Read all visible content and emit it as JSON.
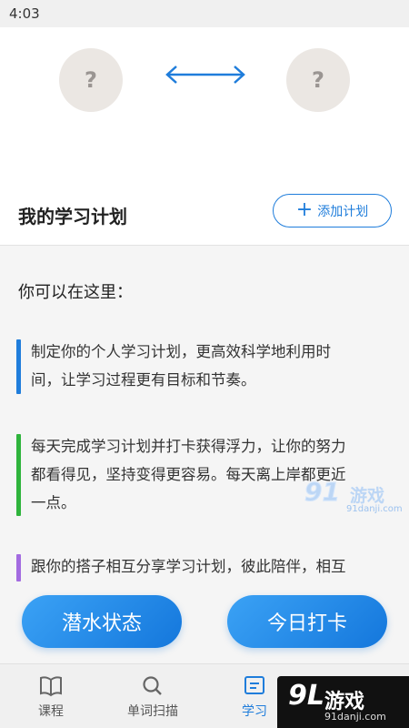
{
  "status_bar": {
    "time": "4:03"
  },
  "header": {
    "left_avatar_text": "?",
    "right_avatar_text": "?",
    "link_icon": "double-arrow-icon",
    "plan_title": "我的学习计划",
    "add_plan_label": "添加计划",
    "add_plan_icon": "plus-icon",
    "accent": "#1f7ddb"
  },
  "content": {
    "intro": "你可以在这里：",
    "items": [
      {
        "text_line1": "制定你的个人学习计划，更高效科学地利用时",
        "text_line2": "间，让学习过程更有目标和节奏。",
        "color": "#1f7ddb"
      },
      {
        "text_line1": "每天完成学习计划并打卡获得浮力，让你的努力",
        "text_line2": "都看得见，坚持变得更容易。每天离上岸都更近",
        "text_line3": "一点。",
        "color": "#2fb43c"
      },
      {
        "text_line1": "跟你的搭子相互分享学习计划，彼此陪伴，相互",
        "color": "#a36be0"
      }
    ]
  },
  "actions": {
    "dive_button": "潜水状态",
    "checkin_button": "今日打卡"
  },
  "bottom_nav": {
    "tabs": [
      {
        "label": "课程",
        "icon": "book-icon"
      },
      {
        "label": "单词扫描",
        "icon": "search-icon"
      },
      {
        "label": "学习",
        "icon": "study-icon"
      },
      {
        "label": "",
        "icon": "profile-icon"
      }
    ]
  },
  "watermark": {
    "small_logo": "91",
    "small_text": "游戏",
    "small_url": "91danji.com",
    "big_logo": "9L",
    "big_text": "游戏",
    "big_url": "91danji.com"
  }
}
